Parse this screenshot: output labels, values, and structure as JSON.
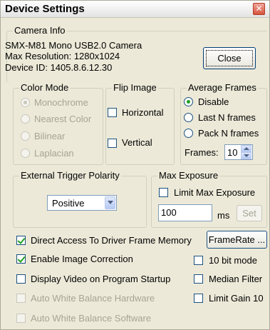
{
  "window": {
    "title": "Device Settings"
  },
  "camera_info": {
    "label": "Camera Info",
    "lines": [
      "SMX-M81 Mono USB2.0 Camera",
      "Max Resolution: 1280x1024",
      "Device ID: 1405.8.6.12.30"
    ]
  },
  "close_button": "Close",
  "color_mode": {
    "label": "Color Mode",
    "options": [
      "Monochrome",
      "Nearest Color",
      "Bilinear",
      "Laplacian"
    ],
    "selected": "Monochrome",
    "enabled": false
  },
  "flip_image": {
    "label": "Flip Image",
    "horizontal": {
      "label": "Horizontal",
      "checked": false
    },
    "vertical": {
      "label": "Vertical",
      "checked": false
    }
  },
  "average_frames": {
    "label": "Average Frames",
    "options": [
      "Disable",
      "Last N frames",
      "Pack N frames"
    ],
    "selected": "Disable",
    "frames_label": "Frames:",
    "frames_value": "10"
  },
  "trigger_polarity": {
    "label": "External Trigger Polarity",
    "value": "Positive"
  },
  "max_exposure": {
    "label": "Max Exposure",
    "limit_label": "Limit Max Exposure",
    "limit_checked": false,
    "value": "100",
    "unit": "ms",
    "set_label": "Set"
  },
  "options": {
    "direct_access": {
      "label": "Direct Access To Driver Frame Memory",
      "checked": true
    },
    "framerate_button": "FrameRate ...",
    "enable_correction": {
      "label": "Enable Image Correction",
      "checked": true
    },
    "ten_bit": {
      "label": "10 bit mode",
      "checked": false
    },
    "display_startup": {
      "label": "Display Video on Program Startup",
      "checked": false
    },
    "median_filter": {
      "label": "Median Filter",
      "checked": false
    },
    "awb_hardware": {
      "label": "Auto White Balance Hardware",
      "checked": false,
      "enabled": false
    },
    "limit_gain": {
      "label": "Limit Gain 10",
      "checked": false
    },
    "awb_software": {
      "label": "Auto White Balance Software",
      "checked": false,
      "enabled": false
    }
  },
  "colors": {
    "dialog_bg": "#ece9d8",
    "check_mark": "#21a121",
    "disabled_text": "#a6a493",
    "close_red": "#d6563f"
  }
}
